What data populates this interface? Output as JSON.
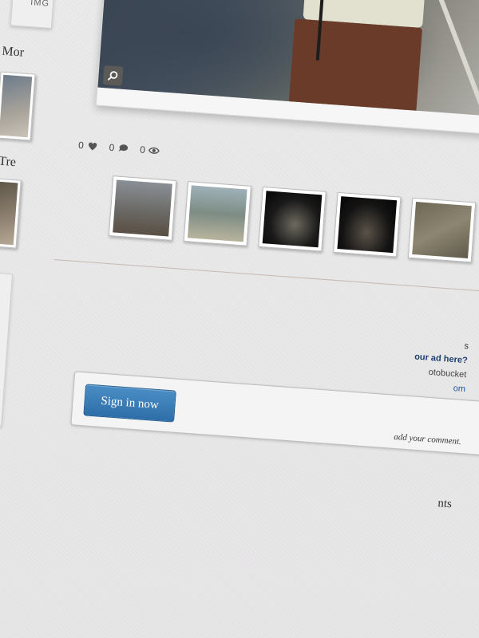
{
  "sidebar": {
    "image_placeholder": "IMG",
    "more_label": "Mor",
    "trending_label": "Tre"
  },
  "hero": {
    "zoom_icon": "magnifier-icon"
  },
  "stats": {
    "likes": "0",
    "comments": "0",
    "views": "0"
  },
  "thumbnails": [
    {
      "name": "shark-on-shore"
    },
    {
      "name": "angler-with-shark"
    },
    {
      "name": "night-shark-catch"
    },
    {
      "name": "night-fishing"
    },
    {
      "name": "fish-on-sand"
    },
    {
      "name": "partial-thumbnail"
    }
  ],
  "ads": {
    "line1": "s",
    "line2": "our ad here?",
    "line3": "otobucket",
    "line4": "om"
  },
  "comment_box": {
    "signin_label": "Sign in now",
    "note": "add your comment."
  },
  "comments": {
    "heading": "nts"
  },
  "colors": {
    "signin_blue": "#2e6ea8",
    "link_blue": "#1b3f6e"
  }
}
